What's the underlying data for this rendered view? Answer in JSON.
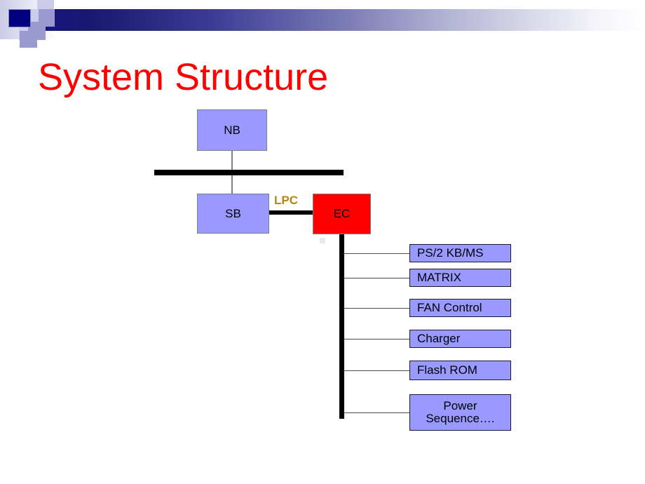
{
  "slide": {
    "title": "System Structure",
    "title_color": "#ff0000",
    "background_color": "#ffffff"
  },
  "header": {
    "gradient_from": "#191970",
    "gradient_to": "#ffffff",
    "accent_navy": "#000080",
    "accent_pale": "#ccccea",
    "accent_medium": "#9a9ad0"
  },
  "diagram": {
    "type": "block-diagram",
    "node_fill_purple": "#9999ff",
    "node_fill_red": "#ff0000",
    "bus_color": "#000000",
    "nodes": [
      {
        "id": "nb",
        "label": "NB",
        "fill": "#9999ff"
      },
      {
        "id": "sb",
        "label": "SB",
        "fill": "#9999ff"
      },
      {
        "id": "ec",
        "label": "EC",
        "fill": "#ff0000"
      }
    ],
    "bus_label": "LPC",
    "bus_label_color": "#b8860b",
    "peripherals": [
      {
        "id": "ps2",
        "label": "PS/2 KB/MS"
      },
      {
        "id": "matrix",
        "label": "MATRIX"
      },
      {
        "id": "fan",
        "label": "FAN Control"
      },
      {
        "id": "charger",
        "label": "Charger"
      },
      {
        "id": "flash",
        "label": "Flash ROM"
      },
      {
        "id": "power",
        "label_line1": "Power",
        "label_line2": "Sequence…."
      }
    ]
  }
}
